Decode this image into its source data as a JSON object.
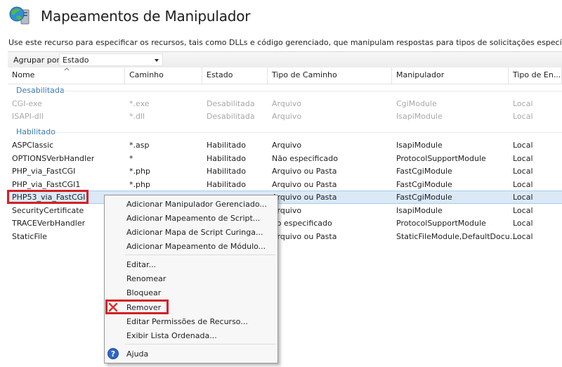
{
  "page": {
    "title": "Mapeamentos de Manipulador",
    "description": "Use este recurso para especificar os recursos, tais como DLLs e código gerenciado, que manipulam respostas para tipos de solicitações específicos."
  },
  "toolbar": {
    "group_label": "Agrupar por:",
    "group_value": "Estado"
  },
  "columns": [
    "Nome",
    "Caminho",
    "Estado",
    "Tipo de Caminho",
    "Manipulador",
    "Tipo de En..."
  ],
  "groups": [
    {
      "title": "Desabilitada",
      "rows": [
        [
          "CGI-exe",
          "*.exe",
          "Desabilitada",
          "Arquivo",
          "CgiModule",
          "Local"
        ],
        [
          "ISAPI-dll",
          "*.dll",
          "Desabilitada",
          "Arquivo",
          "IsapiModule",
          "Local"
        ]
      ]
    },
    {
      "title": "Habilitado",
      "rows": [
        [
          "ASPClassic",
          "*.asp",
          "Habilitado",
          "Arquivo",
          "IsapiModule",
          "Local"
        ],
        [
          "OPTIONSVerbHandler",
          "*",
          "Habilitado",
          "Não especificado",
          "ProtocolSupportModule",
          "Local"
        ],
        [
          "PHP_via_FastCGI",
          "*.php",
          "Habilitado",
          "Arquivo ou Pasta",
          "FastCgiModule",
          "Local"
        ],
        [
          "PHP_via_FastCGI1",
          "*.php",
          "Habilitado",
          "Arquivo ou Pasta",
          "FastCgiModule",
          "Local"
        ],
        [
          "PHP53_via_FastCGI",
          "",
          "",
          "Arquivo ou Pasta",
          "FastCgiModule",
          "Local"
        ],
        [
          "SecurityCertificate",
          "",
          "",
          "Arquivo",
          "IsapiModule",
          "Local"
        ],
        [
          "TRACEVerbHandler",
          "",
          "",
          "ão especificado",
          "ProtocolSupportModule",
          "Local"
        ],
        [
          "StaticFile",
          "",
          "",
          "Arquivo ou Pasta",
          "StaticFileModule,DefaultDocu...",
          "Local"
        ]
      ]
    }
  ],
  "context_menu": {
    "items": [
      "Adicionar Manipulador Gerenciado...",
      "Adicionar Mapeamento de Script...",
      "Adicionar Mapa de Script Curinga...",
      "Adicionar Mapeamento de Módulo...",
      "Editar...",
      "Renomear",
      "Bloquear",
      "Remover",
      "Editar Permissões de Recurso...",
      "Exibir Lista Ordenada...",
      "Ajuda"
    ]
  },
  "colors": {
    "group_title": "#3a78b4",
    "selected_row": "#dbe9f7",
    "annotation": "#d32026",
    "disabled_text": "#a8a8a8"
  },
  "icons": {
    "header": "globe-server-icon",
    "remove": "red-x-icon",
    "help": "help-icon"
  }
}
